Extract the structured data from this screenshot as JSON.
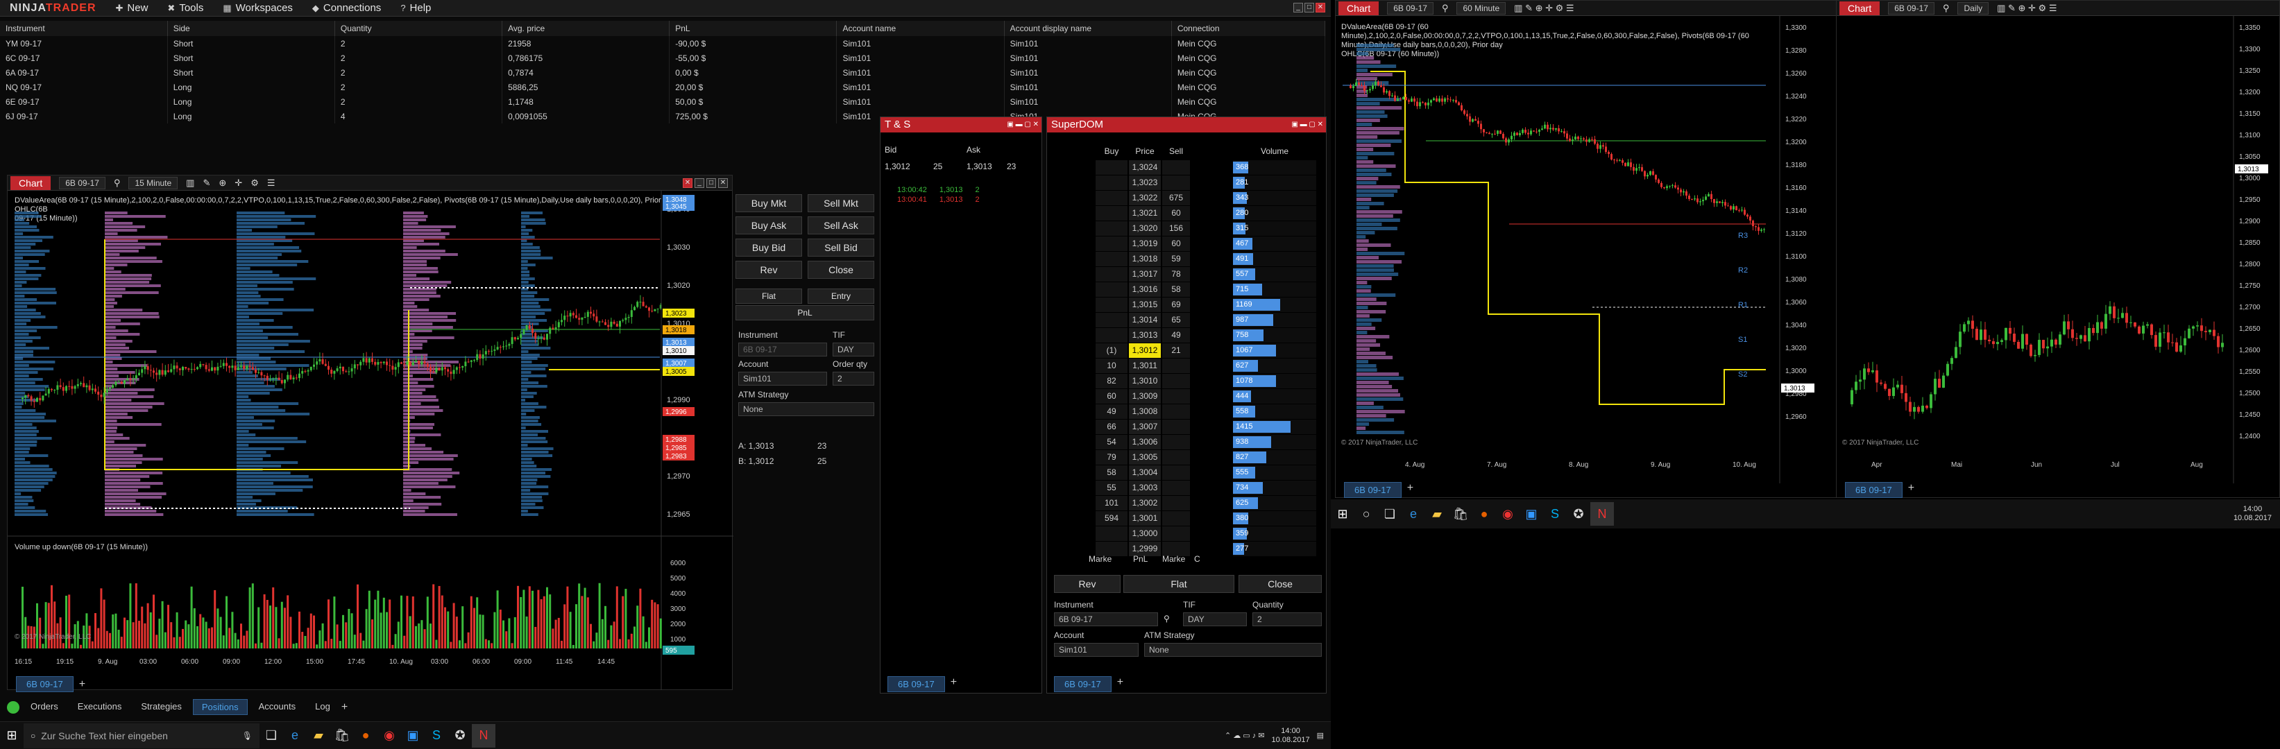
{
  "menubar": {
    "logo_main": "NINJA",
    "logo_accent": "TRADER",
    "items": [
      {
        "icon": "+",
        "label": "New"
      },
      {
        "icon": "✕",
        "label": "Tools"
      },
      {
        "icon": "▦",
        "label": "Workspaces"
      },
      {
        "icon": "♦",
        "label": "Connections"
      },
      {
        "icon": "?",
        "label": "Help"
      }
    ]
  },
  "positions": {
    "headers": [
      "Instrument",
      "Side",
      "Quantity",
      "Avg. price",
      "PnL",
      "Account name",
      "Account display name",
      "Connection"
    ],
    "rows": [
      [
        "YM 09-17",
        "Short",
        "2",
        "21958",
        "-90,00 $",
        "Sim101",
        "Sim101",
        "Mein CQG"
      ],
      [
        "6C 09-17",
        "Short",
        "2",
        "0,786175",
        "-55,00 $",
        "Sim101",
        "Sim101",
        "Mein CQG"
      ],
      [
        "6A 09-17",
        "Short",
        "2",
        "0,7874",
        "0,00 $",
        "Sim101",
        "Sim101",
        "Mein CQG"
      ],
      [
        "NQ 09-17",
        "Long",
        "2",
        "5886,25",
        "20,00 $",
        "Sim101",
        "Sim101",
        "Mein CQG"
      ],
      [
        "6E 09-17",
        "Long",
        "2",
        "1,1748",
        "50,00 $",
        "Sim101",
        "Sim101",
        "Mein CQG"
      ],
      [
        "6J 09-17",
        "Long",
        "4",
        "0,0091055",
        "725,00 $",
        "Sim101",
        "Sim101",
        "Mein CQG"
      ]
    ]
  },
  "main_chart": {
    "title": "Chart",
    "instrument": "6B 09-17",
    "interval": "15 Minute",
    "indicator_text": "DValueArea(6B 09-17 (15 Minute),2,100,2,0,False,00:00:00,0,7,2,2,VTPO,0,100,1,13,15,True,2,False,0,60,300,False,2,False), Pivots(6B 09-17 (15 Minute),Daily,Use daily bars,0,0,0,20), Prior day OHLC(6B",
    "indicator_text2": "09-17 (15 Minute))",
    "volume_label": "Volume up down(6B 09-17 (15 Minute))",
    "copyright": "© 2017 NinjaTrader, LLC",
    "price_ticks": [
      "1,3040",
      "1,3030",
      "1,3020",
      "1,3010",
      "1,3000",
      "1,2990",
      "1,2980",
      "1,2970",
      "1,2965"
    ],
    "vol_ticks": [
      "6000",
      "5000",
      "4000",
      "3000",
      "2000",
      "1000"
    ],
    "time_ticks": [
      "16:15",
      "19:15",
      "9. Aug",
      "03:00",
      "06:00",
      "09:00",
      "12:00",
      "15:00",
      "17:45",
      "10. Aug",
      "03:00",
      "06:00",
      "09:00",
      "11:45",
      "14:45"
    ],
    "badges": [
      "1,3048",
      "1,3045",
      "1,3023",
      "1,3018",
      "1,3013",
      "1,3010",
      "1,3007",
      "1,3005",
      "1,2996",
      "1,2988",
      "1,2985",
      "1,2983",
      "595"
    ],
    "tab": "6B 09-17"
  },
  "order_panel": {
    "buy_mkt": "Buy Mkt",
    "sell_mkt": "Sell Mkt",
    "buy_ask": "Buy Ask",
    "sell_ask": "Sell Ask",
    "buy_bid": "Buy Bid",
    "sell_bid": "Sell Bid",
    "rev": "Rev",
    "close": "Close",
    "flat": "Flat",
    "entry": "Entry",
    "pnl": "PnL",
    "instrument_lbl": "Instrument",
    "instrument": "6B 09-17",
    "tif_lbl": "TIF",
    "tif": "DAY",
    "account_lbl": "Account",
    "account": "Sim101",
    "qty_lbl": "Order qty",
    "qty": "2",
    "atm_lbl": "ATM Strategy",
    "atm": "None",
    "a_line": "A:  1,3013",
    "a_val": "23",
    "b_line": "B:  1,3012",
    "b_val": "25"
  },
  "ts": {
    "title": "T & S",
    "bid_lbl": "Bid",
    "ask_lbl": "Ask",
    "bid": "1,3012",
    "bid_sz": "25",
    "ask": "1,3013",
    "ask_sz": "23",
    "trades": [
      {
        "t": "13:00:42",
        "p": "1,3013",
        "s": "2",
        "c": "#3bbb3b"
      },
      {
        "t": "13:00:41",
        "p": "1,3013",
        "s": "2",
        "c": "#e0332f"
      }
    ],
    "tab": "6B 09-17"
  },
  "superdom": {
    "title": "SuperDOM",
    "h_buy": "Buy",
    "h_price": "Price",
    "h_sell": "Sell",
    "h_vol": "Volume",
    "rows": [
      {
        "p": "1,3024",
        "buy": "",
        "sell": "",
        "v": "368",
        "w": 0.18
      },
      {
        "p": "1,3023",
        "buy": "",
        "sell": "",
        "v": "281",
        "w": 0.14
      },
      {
        "p": "1,3022",
        "buy": "",
        "sell": "675",
        "v": "343",
        "w": 0.17
      },
      {
        "p": "1,3021",
        "buy": "",
        "sell": "60",
        "v": "280",
        "w": 0.14
      },
      {
        "p": "1,3020",
        "buy": "",
        "sell": "156",
        "v": "315",
        "w": 0.15
      },
      {
        "p": "1,3019",
        "buy": "",
        "sell": "60",
        "v": "467",
        "w": 0.23
      },
      {
        "p": "1,3018",
        "buy": "",
        "sell": "59",
        "v": "491",
        "w": 0.24
      },
      {
        "p": "1,3017",
        "buy": "",
        "sell": "78",
        "v": "557",
        "w": 0.27
      },
      {
        "p": "1,3016",
        "buy": "",
        "sell": "58",
        "v": "715",
        "w": 0.35
      },
      {
        "p": "1,3015",
        "buy": "",
        "sell": "69",
        "v": "1169",
        "w": 0.57
      },
      {
        "p": "1,3014",
        "buy": "",
        "sell": "65",
        "v": "987",
        "w": 0.48
      },
      {
        "p": "1,3013",
        "buy": "",
        "sell": "49",
        "v": "758",
        "w": 0.37
      },
      {
        "p": "1,3012",
        "buy": "(1)",
        "sell": "21",
        "v": "1067",
        "w": 0.52,
        "hl": true
      },
      {
        "p": "1,3011",
        "buy": "10",
        "sell": "",
        "v": "627",
        "w": 0.3
      },
      {
        "p": "1,3010",
        "buy": "82",
        "sell": "",
        "v": "1078",
        "w": 0.52
      },
      {
        "p": "1,3009",
        "buy": "60",
        "sell": "",
        "v": "444",
        "w": 0.22
      },
      {
        "p": "1,3008",
        "buy": "49",
        "sell": "",
        "v": "558",
        "w": 0.27
      },
      {
        "p": "1,3007",
        "buy": "66",
        "sell": "",
        "v": "1415",
        "w": 0.69
      },
      {
        "p": "1,3006",
        "buy": "54",
        "sell": "",
        "v": "938",
        "w": 0.46
      },
      {
        "p": "1,3005",
        "buy": "79",
        "sell": "",
        "v": "827",
        "w": 0.4
      },
      {
        "p": "1,3004",
        "buy": "58",
        "sell": "",
        "v": "555",
        "w": 0.27
      },
      {
        "p": "1,3003",
        "buy": "55",
        "sell": "",
        "v": "734",
        "w": 0.36
      },
      {
        "p": "1,3002",
        "buy": "101",
        "sell": "",
        "v": "625",
        "w": 0.3
      },
      {
        "p": "1,3001",
        "buy": "594",
        "sell": "",
        "v": "380",
        "w": 0.18
      },
      {
        "p": "1,3000",
        "buy": "",
        "sell": "",
        "v": "359",
        "w": 0.17
      },
      {
        "p": "1,2999",
        "buy": "",
        "sell": "",
        "v": "277",
        "w": 0.13
      }
    ],
    "marke": "Marke",
    "pnl": "PnL",
    "marke2": "Marke",
    "c": "C",
    "rev": "Rev",
    "flat": "Flat",
    "close": "Close",
    "instrument_lbl": "Instrument",
    "instrument": "6B 09-17",
    "tif_lbl": "TIF",
    "tif": "DAY",
    "qty_lbl": "Quantity",
    "qty": "2",
    "account_lbl": "Account",
    "account": "Sim101",
    "atm_lbl": "ATM Strategy",
    "atm": "None",
    "tab": "6B 09-17"
  },
  "bottom_tabs": [
    "Orders",
    "Executions",
    "Strategies",
    "Positions",
    "Accounts",
    "Log"
  ],
  "taskbar": {
    "search": "Zur Suche Text hier eingeben",
    "time": "14:00",
    "date": "10.08.2017"
  },
  "chart2": {
    "title": "Chart",
    "instrument": "6B 09-17",
    "interval": "60 Minute",
    "indicator": "DValueArea(6B 09-17 (60 Minute),2,100,2,0,False,00:00:00,0,7,2,2,VTPO,0,100,1,13,15,True,2,False,0,60,300,False,2,False), Pivots(6B 09-17 (60 Minute),Daily,Use daily bars,0,0,0,20), Prior day",
    "indicator2": "OHLC(6B 09-17 (60 Minute))",
    "price_ticks": [
      "1,3300",
      "1,3280",
      "1,3260",
      "1,3240",
      "1,3220",
      "1,3200",
      "1,3180",
      "1,3160",
      "1,3140",
      "1,3120",
      "1,3100",
      "1,3080",
      "1,3060",
      "1,3040",
      "1,3020",
      "1,3000",
      "1,2980",
      "1,2960"
    ],
    "time_ticks": [
      "4. Aug",
      "7. Aug",
      "8. Aug",
      "9. Aug",
      "10. Aug"
    ],
    "labels": [
      "R3",
      "R2",
      "R1",
      "S1",
      "S2"
    ],
    "current": "1,3013",
    "copyright": "© 2017 NinjaTrader, LLC",
    "tab": "6B 09-17"
  },
  "chart3": {
    "title": "Chart",
    "instrument": "6B 09-17",
    "interval": "Daily",
    "price_ticks": [
      "1,3350",
      "1,3300",
      "1,3250",
      "1,3200",
      "1,3150",
      "1,3100",
      "1,3050",
      "1,3000",
      "1,2950",
      "1,2900",
      "1,2850",
      "1,2800",
      "1,2750",
      "1,2700",
      "1,2650",
      "1,2600",
      "1,2550",
      "1,2500",
      "1,2450",
      "1,2400"
    ],
    "time_ticks": [
      "Apr",
      "Mai",
      "Jun",
      "Jul",
      "Aug"
    ],
    "current": "1,3013",
    "copyright": "© 2017 NinjaTrader, LLC",
    "tab": "6B 09-17"
  },
  "right_taskbar": {
    "time": "14:00",
    "date": "10.08.2017"
  },
  "colors": {
    "red": "#c1272d",
    "blue": "#4a90e2",
    "green": "#3bbb3b",
    "purple": "#b06ab3",
    "yellow": "#f2e40c"
  }
}
